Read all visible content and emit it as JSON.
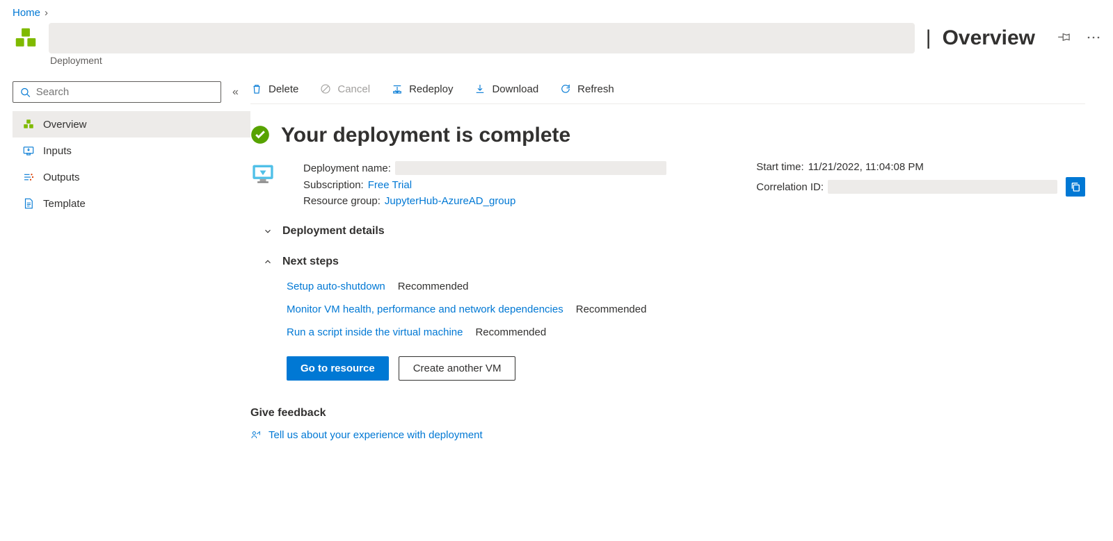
{
  "breadcrumb": {
    "home": "Home"
  },
  "header": {
    "title": "Overview",
    "subtitle": "Deployment"
  },
  "search": {
    "placeholder": "Search"
  },
  "sidebar": {
    "items": [
      {
        "label": "Overview"
      },
      {
        "label": "Inputs"
      },
      {
        "label": "Outputs"
      },
      {
        "label": "Template"
      }
    ]
  },
  "toolbar": {
    "delete": "Delete",
    "cancel": "Cancel",
    "redeploy": "Redeploy",
    "download": "Download",
    "refresh": "Refresh"
  },
  "status": {
    "heading": "Your deployment is complete"
  },
  "details": {
    "deployment_name_label": "Deployment name:",
    "subscription_label": "Subscription:",
    "subscription_value": "Free Trial",
    "resource_group_label": "Resource group:",
    "resource_group_value": "JupyterHub-AzureAD_group",
    "start_time_label": "Start time:",
    "start_time_value": "11/21/2022, 11:04:08 PM",
    "correlation_label": "Correlation ID:"
  },
  "sections": {
    "deployment_details": "Deployment details",
    "next_steps": "Next steps"
  },
  "steps": [
    {
      "link": "Setup auto-shutdown",
      "tag": "Recommended"
    },
    {
      "link": "Monitor VM health, performance and network dependencies",
      "tag": "Recommended"
    },
    {
      "link": "Run a script inside the virtual machine",
      "tag": "Recommended"
    }
  ],
  "buttons": {
    "go_to_resource": "Go to resource",
    "create_another": "Create another VM"
  },
  "feedback": {
    "heading": "Give feedback",
    "link": "Tell us about your experience with deployment"
  }
}
